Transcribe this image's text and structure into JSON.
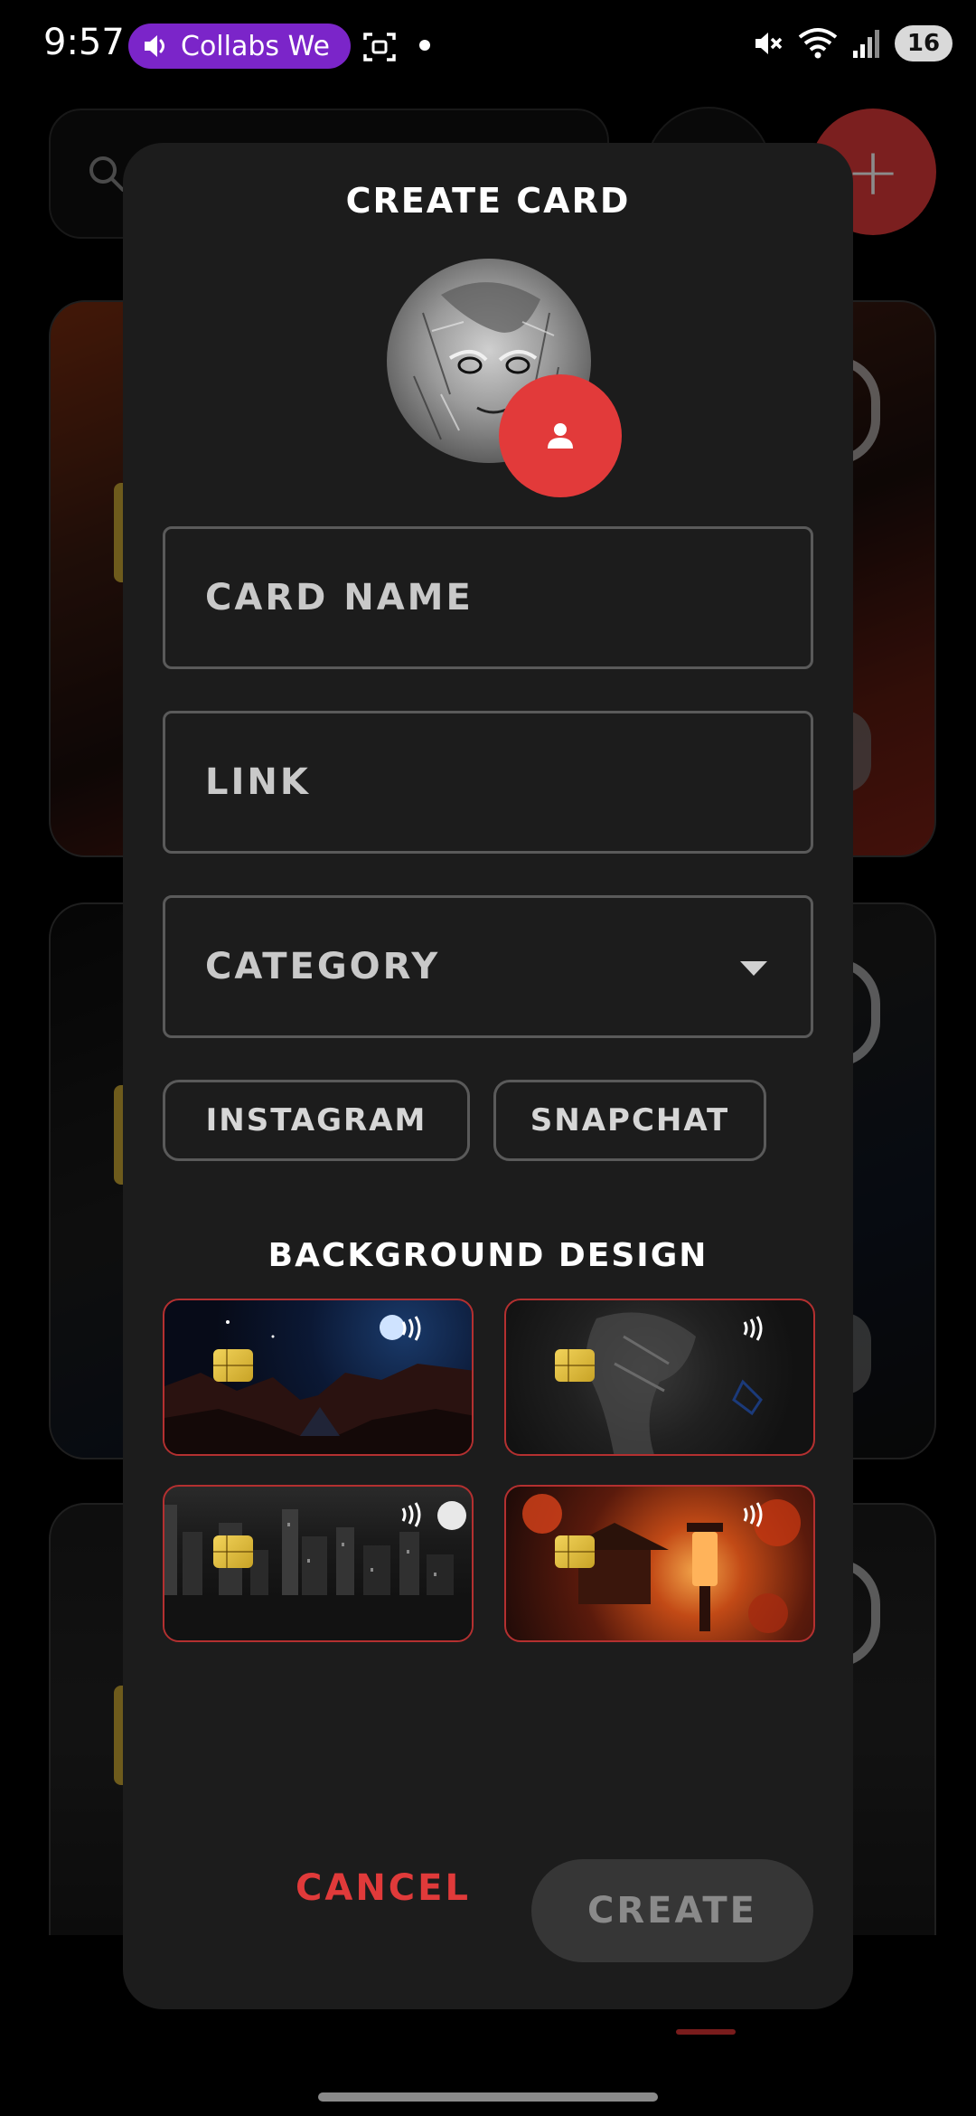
{
  "status_bar": {
    "time": "9:57",
    "media_pill_text": "Collabs We",
    "media_pill_color": "#7b25c9",
    "battery": "16",
    "icons": [
      "speaker-icon",
      "screenshot-icon",
      "mute-icon",
      "wifi-icon",
      "signal-icon"
    ]
  },
  "background_app": {
    "accent_color": "#e03a3a",
    "add_button_label": "+"
  },
  "dialog": {
    "title": "CREATE CARD",
    "avatar_edit_icon": "person-icon",
    "fields": {
      "card_name_placeholder": "CARD NAME",
      "link_placeholder": "LINK",
      "category_placeholder": "CATEGORY"
    },
    "chips": [
      "INSTAGRAM",
      "SNAPCHAT"
    ],
    "background_section_title": "BACKGROUND DESIGN",
    "designs": [
      "night-canyon-moon",
      "dark-samurai",
      "city-skyline-moon",
      "autumn-lantern"
    ],
    "cancel_label": "CANCEL",
    "create_label": "CREATE",
    "colors": {
      "dialog_bg": "#1c1c1c",
      "accent": "#e23a3a",
      "create_disabled_bg": "#363636"
    }
  }
}
